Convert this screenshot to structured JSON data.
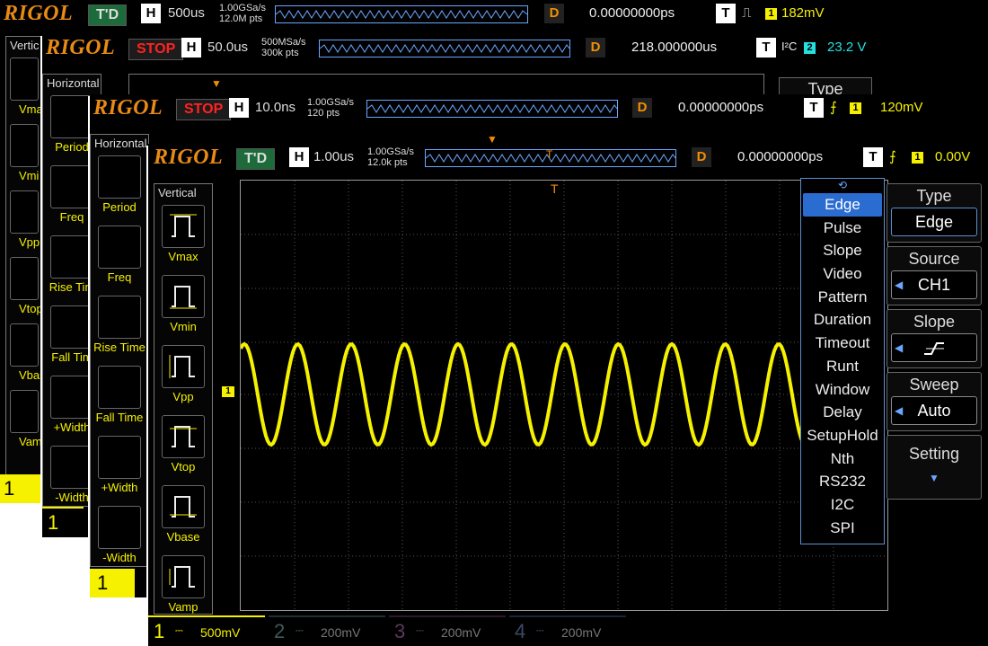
{
  "brand": "RIGOL",
  "screens": [
    {
      "state": "T'D",
      "h_label": "H",
      "timebase": "500us",
      "rate_line1": "1.00GSa/s",
      "rate_line2": "12.0M pts",
      "d_label": "D",
      "delay": "0.00000000ps",
      "t_label": "T",
      "trig_channel": "1",
      "trig_level": "182mV",
      "panel_title": "Vertic",
      "meas_labels": [
        "Vma",
        "Vmi",
        "Vpp",
        "Vtop",
        "Vbas",
        "Vam"
      ],
      "ch_scale_visible": "1"
    },
    {
      "state": "STOP",
      "h_label": "H",
      "timebase": "50.0us",
      "rate_line1": "500MSa/s",
      "rate_line2": "300k pts",
      "d_label": "D",
      "delay": "218.000000us",
      "t_label": "T",
      "trig_type_text": "I²C",
      "trig_channel": "2",
      "trig_level": "23.2 V",
      "panel_title": "Horizontal",
      "meas_labels": [
        "Period",
        "Freq",
        "Rise Tim",
        "Fall Tim",
        "+Width",
        "-Width"
      ],
      "side_type_header": "Type",
      "ch_scale_visible": "1"
    },
    {
      "state": "STOP",
      "h_label": "H",
      "timebase": "10.0ns",
      "rate_line1": "1.00GSa/s",
      "rate_line2": "120  pts",
      "d_label": "D",
      "delay": "0.00000000ps",
      "t_label": "T",
      "trig_channel": "1",
      "trig_level": "120mV",
      "panel_title": "Horizontal",
      "meas_labels": [
        "Period",
        "Freq",
        "Rise Time",
        "Fall Time",
        "+Width",
        "-Width"
      ],
      "ch_scale_visible": "1"
    },
    {
      "state": "T'D",
      "h_label": "H",
      "timebase": "1.00us",
      "rate_line1": "1.00GSa/s",
      "rate_line2": "12.0k pts",
      "d_label": "D",
      "delay": "0.00000000ps",
      "t_label": "T",
      "trig_channel": "1",
      "trig_level": "0.00V",
      "panel_title": "Vertical",
      "meas_labels": [
        "Vmax",
        "Vmin",
        "Vpp",
        "Vtop",
        "Vbase",
        "Vamp"
      ],
      "trigger_menu": [
        "Edge",
        "Pulse",
        "Slope",
        "Video",
        "Pattern",
        "Duration",
        "Timeout",
        "Runt",
        "Window",
        "Delay",
        "SetupHold",
        "Nth",
        "RS232",
        "I2C",
        "SPI"
      ],
      "side": {
        "type_header": "Type",
        "type_value": "Edge",
        "source_header": "Source",
        "source_value": "CH1",
        "slope_header": "Slope",
        "sweep_header": "Sweep",
        "sweep_value": "Auto",
        "setting_label": "Setting"
      },
      "channels": [
        {
          "num": "1",
          "scale": "500mV"
        },
        {
          "num": "2",
          "scale": "200mV"
        },
        {
          "num": "3",
          "scale": "200mV"
        },
        {
          "num": "4",
          "scale": "200mV"
        }
      ],
      "ch1_marker": "1",
      "trigger_marker": "T"
    }
  ],
  "colors": {
    "ch1": "#f5f100",
    "ch2": "#25e0e0",
    "ch3": "#d040c0",
    "ch4": "#3a8cff",
    "brand": "#e98a16",
    "menu_accent": "#2b6cd0"
  }
}
